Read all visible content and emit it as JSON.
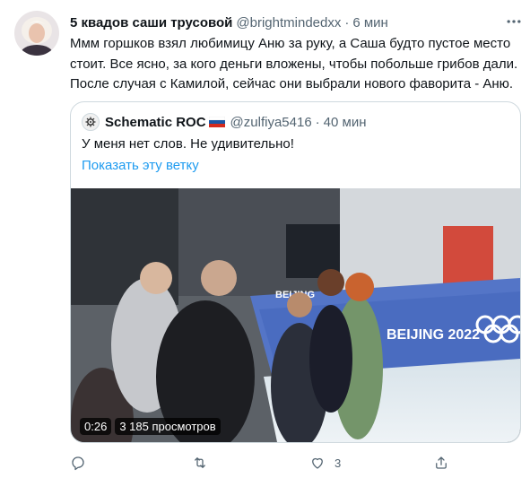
{
  "tweet": {
    "display_name": "5 квадов саши трусовой",
    "handle": "@brightmindedxx",
    "separator": "·",
    "time": "6 мин",
    "text_lines": [
      "Ммм горшков взял любимицу Аню за руку, а Саша будто пустое место",
      "стоит. Все ясно, за кого деньги вложены, чтобы побольше грибов дали.",
      "После случая с Камилой, сейчас они выбрали нового фаворита - Аню."
    ]
  },
  "quote": {
    "display_name": "Schematic ROC",
    "handle": "@zulfiya5416",
    "separator": "·",
    "time": "40 мин",
    "text": "У меня нет слов. Не удивительно!",
    "show_thread": "Показать эту ветку",
    "video": {
      "duration": "0:26",
      "views": "3 185 просмотров",
      "banner_left": "BEIJING",
      "banner_right": "BEIJING 2022"
    }
  },
  "actions": {
    "reply_icon": "reply-icon",
    "retweet_icon": "retweet-icon",
    "like_icon": "like-icon",
    "like_count": "3",
    "share_icon": "share-icon"
  },
  "colors": {
    "link": "#1d9bf0",
    "secondary": "#536471",
    "border": "#cfd9de",
    "primary_text": "#0f1419"
  }
}
